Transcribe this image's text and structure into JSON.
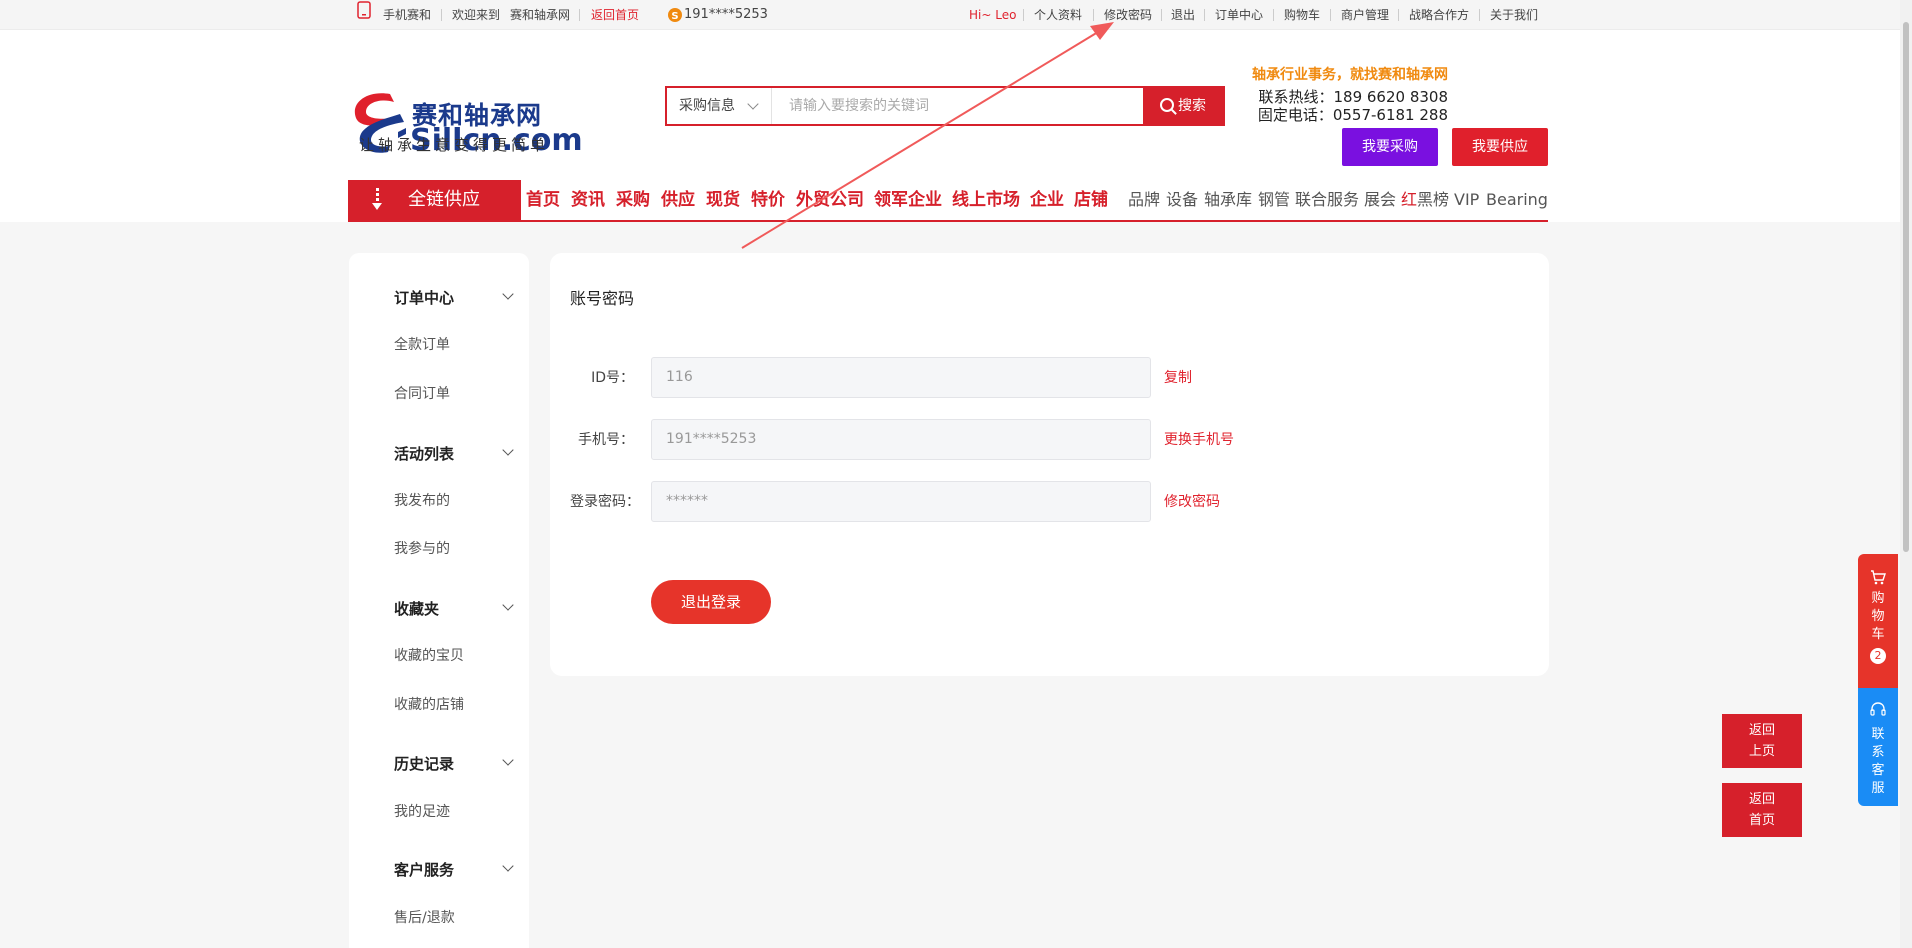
{
  "topbar": {
    "mobile": "手机赛和",
    "welcome": "欢迎来到",
    "site": "赛和轴承网",
    "back_home": "返回首页",
    "phone": "191****5253",
    "greeting": "Hi~ Leo",
    "links": [
      "个人资料",
      "修改密码",
      "退出",
      "订单中心",
      "购物车",
      "商户管理",
      "战略合作方",
      "关于我们"
    ]
  },
  "header": {
    "logo_brand": "赛和轴承网",
    "logo_domain": "Sillcn.com",
    "slogan": "让轴承生意变得更简单",
    "search": {
      "category": "采购信息",
      "placeholder": "请输入要搜索的关键词",
      "button": "搜索"
    },
    "tagline": "轴承行业事务，就找赛和轴承网",
    "hotline": "联系热线：189 6620 8308",
    "landline": "固定电话：0557-6181 288",
    "buy_button": "我要采购",
    "supply_button": "我要供应"
  },
  "nav": {
    "category": "全链供应",
    "primary": [
      "首页",
      "资讯",
      "采购",
      "供应",
      "现货",
      "特价",
      "外贸公司",
      "领军企业",
      "线上市场",
      "企业",
      "店铺"
    ],
    "secondary": [
      "品牌",
      "设备",
      "轴承库",
      "钢管",
      "联合服务",
      "展会"
    ],
    "blacklist_red": "红",
    "blacklist_rest": "黑榜",
    "vip": "VIP",
    "bearing": "Bearing"
  },
  "sidebar": {
    "groups": [
      {
        "title": "订单中心",
        "items": [
          "全款订单",
          "合同订单"
        ]
      },
      {
        "title": "活动列表",
        "items": [
          "我发布的",
          "我参与的"
        ]
      },
      {
        "title": "收藏夹",
        "items": [
          "收藏的宝贝",
          "收藏的店铺"
        ]
      },
      {
        "title": "历史记录",
        "items": [
          "我的足迹"
        ]
      },
      {
        "title": "客户服务",
        "items": [
          "售后/退款"
        ]
      }
    ]
  },
  "main": {
    "title": "账号密码",
    "fields": [
      {
        "label": "ID号：",
        "value": "116",
        "action": "复制"
      },
      {
        "label": "手机号：",
        "value": "191****5253",
        "action": "更换手机号"
      },
      {
        "label": "登录密码：",
        "value": "******",
        "action": "修改密码"
      }
    ],
    "logout": "退出登录"
  },
  "floating": {
    "back_up": [
      "返回",
      "上页"
    ],
    "back_home": [
      "返回",
      "首页"
    ],
    "cart": "购物车",
    "cart_count": "2",
    "service": "联系客服"
  },
  "colors": {
    "brand_red": "#d6202b",
    "purple": "#7a10e0",
    "orange": "#f08a10",
    "blue": "#1a8cf5"
  }
}
